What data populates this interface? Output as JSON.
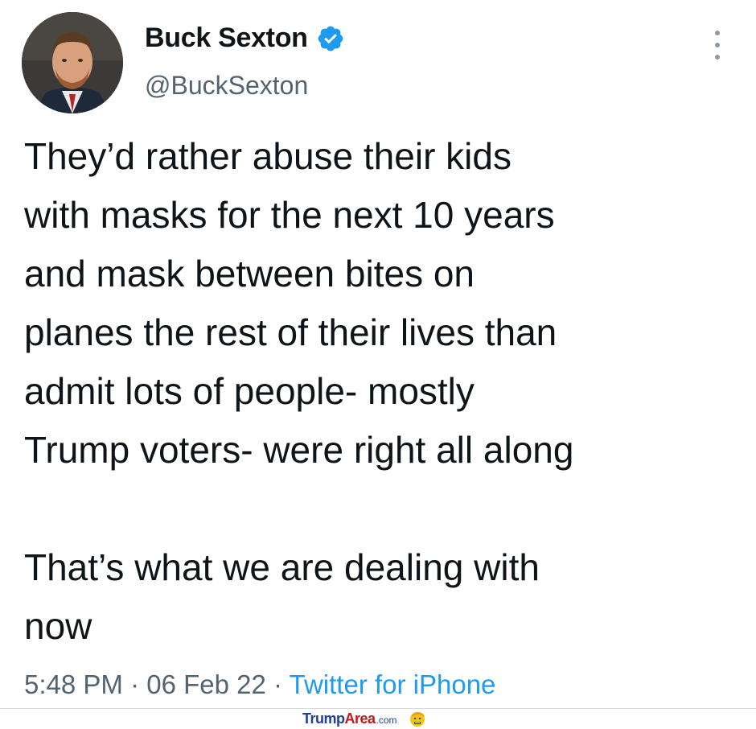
{
  "tweet": {
    "author_name": "Buck Sexton",
    "handle": "@BuckSexton",
    "verified": true,
    "body_lines": [
      "They’d rather abuse their kids",
      "with masks for the next 10 years",
      "and mask between bites on",
      "planes the rest of their lives than",
      "admit lots of people- mostly",
      "Trump voters- were right all along"
    ],
    "body_lines_2": [
      "That’s what we are dealing with",
      "now"
    ],
    "time": "5:48 PM",
    "separator": "·",
    "date": "06 Feb 22",
    "source": "Twitter for iPhone"
  },
  "watermark": {
    "part1": "Trump",
    "part2": "Area",
    "part3": ".com"
  },
  "icons": {
    "verified": "verified-badge-icon",
    "more": "more-options-icon",
    "watermark_face": "trump-face-logo"
  },
  "colors": {
    "text": "#0f1419",
    "secondary": "#536471",
    "link": "#1d9bf0",
    "verified": "#1d9bf0"
  }
}
